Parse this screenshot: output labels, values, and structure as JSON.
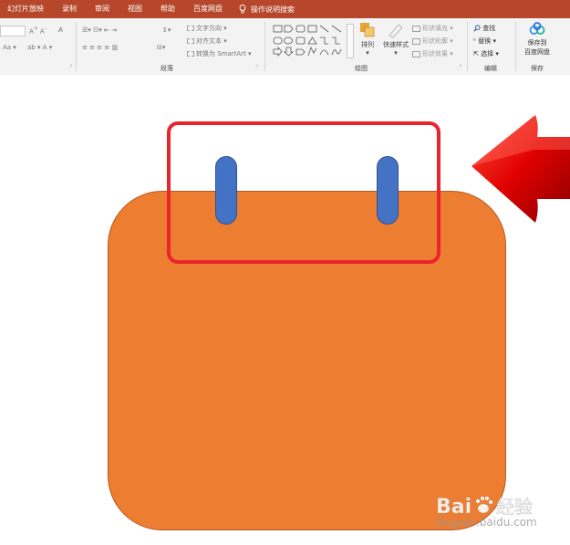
{
  "tabs": [
    "幻灯片放映",
    "录制",
    "审阅",
    "视图",
    "帮助",
    "百度网盘"
  ],
  "tell_me": "操作说明搜索",
  "ribbon": {
    "paragraph": {
      "label": "段落",
      "text_direction": "文字方向",
      "align_text": "对齐文本",
      "smartart": "转换为 SmartArt"
    },
    "drawing": {
      "label": "绘图",
      "arrange": "排列",
      "quick_styles": "快速样式",
      "shape_fill": "形状填充",
      "shape_outline": "形状轮廓",
      "shape_effects": "形状效果"
    },
    "editing": {
      "label": "编辑",
      "find": "查找",
      "replace": "替换",
      "select": "选择"
    },
    "save": {
      "label": "保存",
      "button_line1": "保存到",
      "button_line2": "百度网盘"
    }
  },
  "colors": {
    "tabbar": "#b7472a",
    "calendar_body": "#ed7d31",
    "calendar_rings": "#4472c4",
    "highlight_box": "#e8242c",
    "arrow": "#e00000"
  },
  "icons": [
    "lightbulb-icon",
    "arrange-icon",
    "quick-styles-icon",
    "find-icon",
    "replace-icon",
    "select-icon",
    "baidu-netdisk-icon"
  ],
  "watermark": {
    "brand": "Bai",
    "text": "经验",
    "url": "jingyan.baidu.com"
  }
}
